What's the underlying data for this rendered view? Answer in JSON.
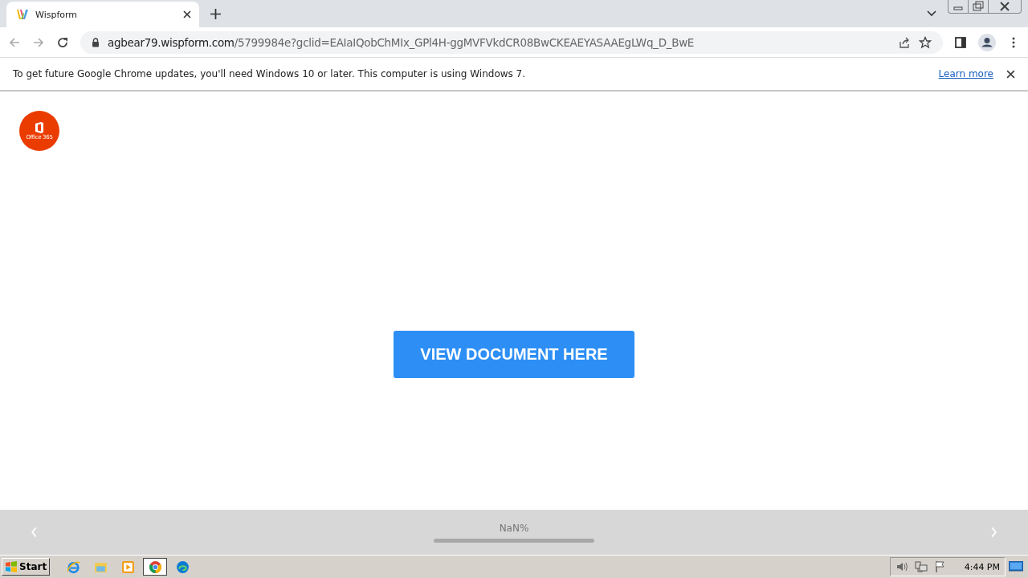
{
  "browser": {
    "tab": {
      "title": "Wispform",
      "selected": true
    },
    "address": {
      "host": "agbear79.wispform.com",
      "path": "/5799984e?gclid=EAIaIQobChMIx_GPl4H-ggMVFVkdCR08BwCKEAEYASAAEgLWq_D_BwE"
    }
  },
  "infobar": {
    "message": "To get future Google Chrome updates, you'll need Windows 10 or later. This computer is using Windows 7.",
    "link": "Learn more"
  },
  "page": {
    "logo_text": "Office 365",
    "button": "VIEW DOCUMENT HERE",
    "footer": {
      "progress_text": "NaN%"
    }
  },
  "taskbar": {
    "start": "Start",
    "apps": [
      {
        "kind": "ie",
        "selected": false
      },
      {
        "kind": "explorer",
        "selected": false
      },
      {
        "kind": "media",
        "selected": false
      },
      {
        "kind": "chrome",
        "selected": true
      },
      {
        "kind": "edge",
        "selected": false
      }
    ],
    "clock": "4:44 PM"
  }
}
